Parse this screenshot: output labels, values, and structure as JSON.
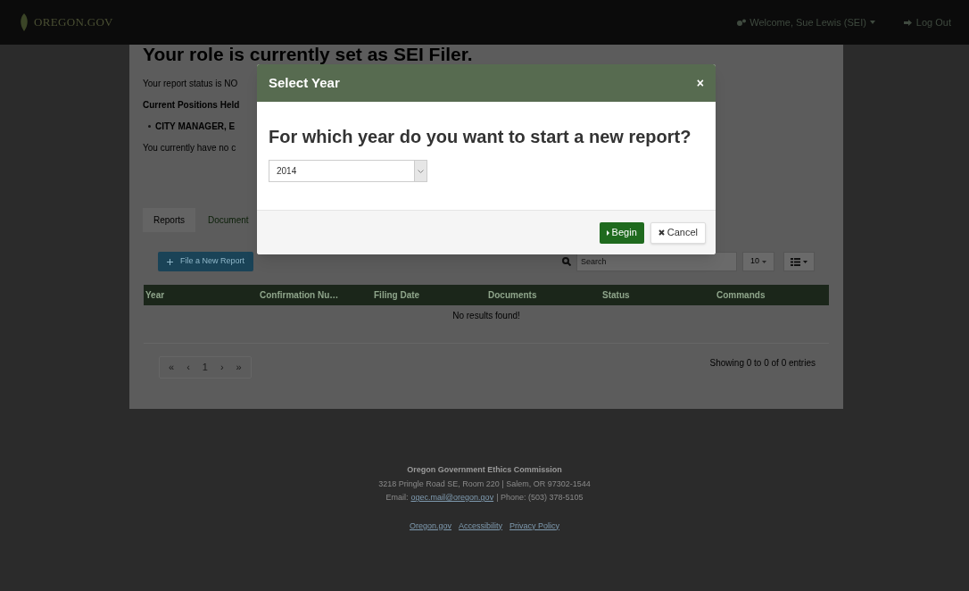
{
  "navbar": {
    "logo": "OREGON.GOV",
    "welcome": "Welcome, Sue Lewis (SEI)",
    "logout": "Log Out"
  },
  "page": {
    "heading": "Your role is currently set as SEI Filer.",
    "status_line": "Your report status is NO",
    "positions_label": "Current Positions Held",
    "positions": [
      "CITY MANAGER, E"
    ],
    "notice": "You currently have no c"
  },
  "tabs": [
    {
      "label": "Reports",
      "selected": true
    },
    {
      "label": "Document",
      "selected": false
    }
  ],
  "toolbar": {
    "new_report": "File a New Report",
    "search_placeholder": "Search",
    "page_size": "10"
  },
  "table": {
    "columns": [
      "Year",
      "Confirmation Nu…",
      "Filing Date",
      "Documents",
      "Status",
      "Commands"
    ],
    "empty": "No results found!"
  },
  "pagination": [
    "«",
    "‹",
    "1",
    "›",
    "»"
  ],
  "entries": "Showing 0 to 0 of 0 entries",
  "footer": {
    "name": "Oregon Government Ethics Commission",
    "address": "3218 Pringle Road SE, Room 220 | Salem, OR 97302-1544",
    "email_label": "Email:",
    "email": "ogec.mail@oregon.gov",
    "phone": "| Phone: (503) 378-5105",
    "links": [
      "Oregon.gov",
      "Accessibility",
      "Privacy Policy"
    ]
  },
  "modal": {
    "title": "Select Year",
    "close": "×",
    "question": "For which year do you want to start a new report?",
    "year": "2014",
    "begin": "Begin",
    "cancel": "Cancel"
  }
}
